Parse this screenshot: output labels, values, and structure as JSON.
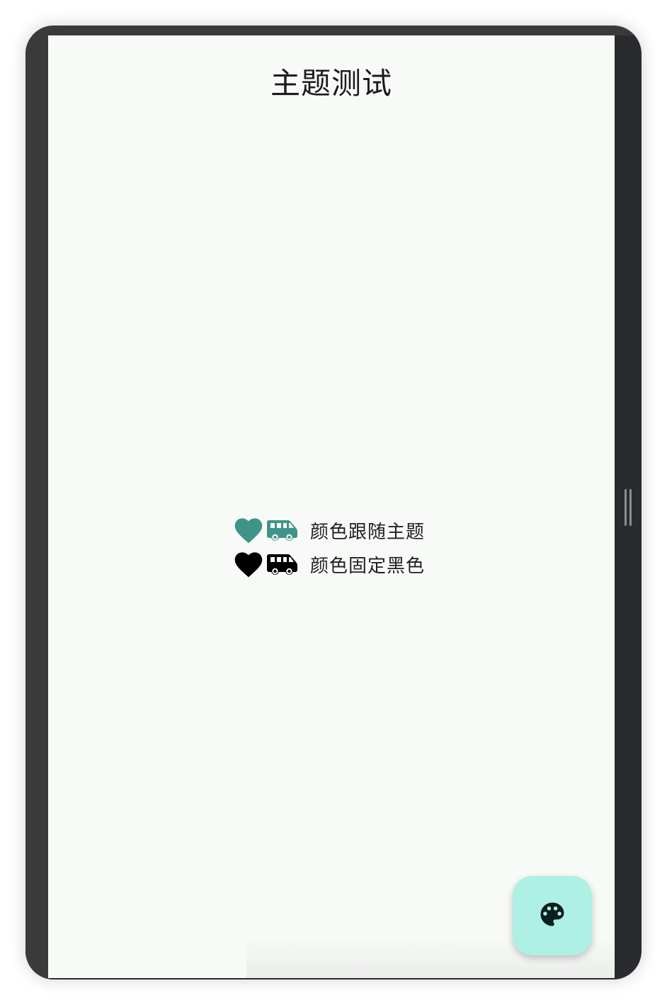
{
  "app": {
    "title": "主题测试"
  },
  "rows": [
    {
      "label": "颜色跟随主题",
      "icon_color": "#3f948a",
      "icons": [
        "heart-icon",
        "bus-icon"
      ]
    },
    {
      "label": "颜色固定黑色",
      "icon_color": "#000000",
      "icons": [
        "heart-icon",
        "bus-icon"
      ]
    }
  ],
  "fab": {
    "icon": "palette-icon",
    "background": "#aef0e4",
    "icon_color": "#0b1f1c"
  },
  "colors": {
    "screen_background": "#f8faf8",
    "device_frame": "#2a2b2e"
  }
}
